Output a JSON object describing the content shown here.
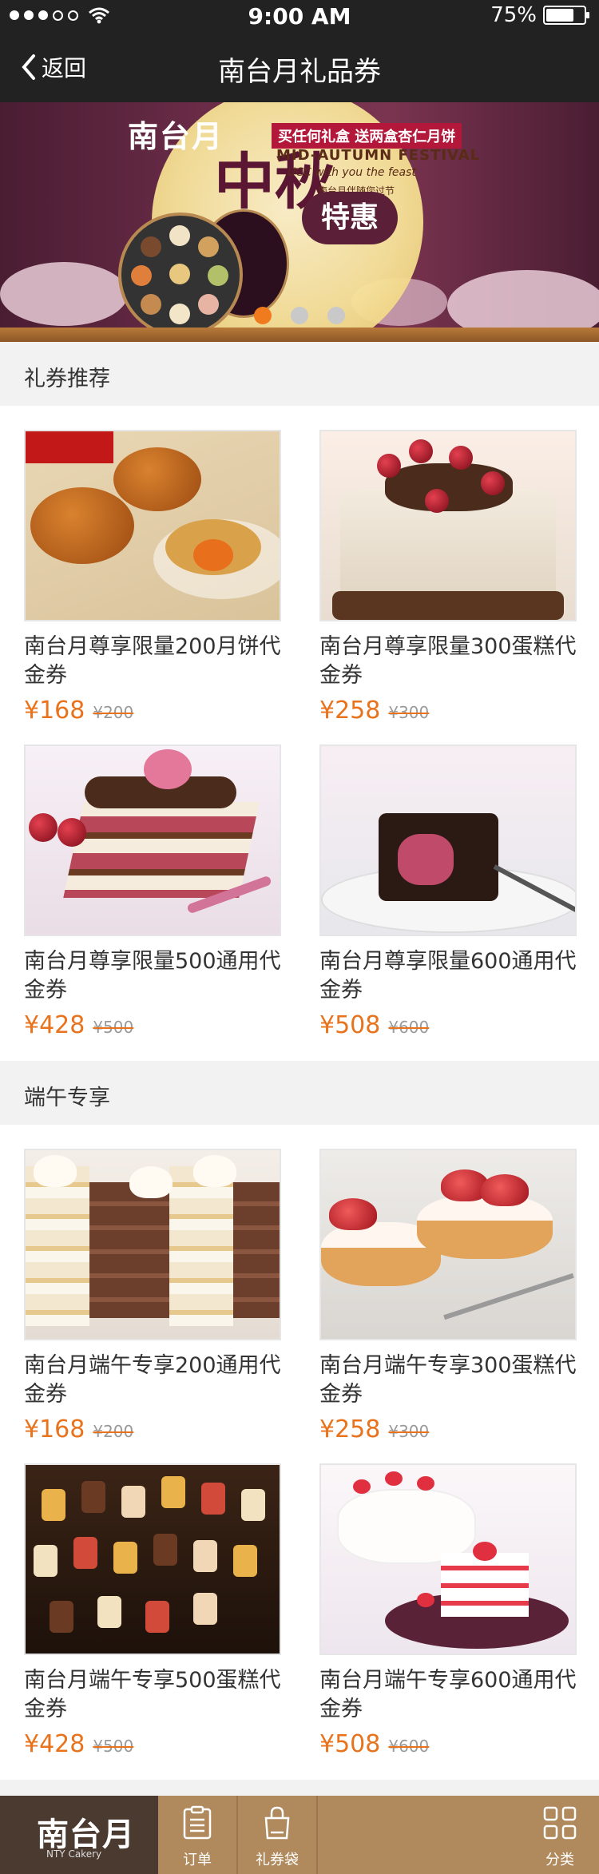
{
  "status_bar": {
    "time": "9:00 AM",
    "battery": "75%",
    "battery_level": 0.75
  },
  "nav": {
    "back_label": "返回",
    "title": "南台月礼品券"
  },
  "banner": {
    "brand": "南台月",
    "tag": "买任何礼盒 送两盒杏仁月饼",
    "title_en": "MID-AUTUMN FESTIVAL",
    "subtitle_en": "UCC with you the feast",
    "subtitle_cn": "南台月伴随您过节",
    "headline": "中秋",
    "badge": "特惠",
    "pager_count": 3,
    "pager_active": 0
  },
  "sections": [
    {
      "title": "礼券推荐",
      "items": [
        {
          "title": "南台月尊享限量200月饼代金券",
          "price": "¥168",
          "old_price": "¥200",
          "image": "mooncake"
        },
        {
          "title": "南台月尊享限量300蛋糕代金券",
          "price": "¥258",
          "old_price": "¥300",
          "image": "cherry-cake"
        },
        {
          "title": "南台月尊享限量500通用代金券",
          "price": "¥428",
          "old_price": "¥500",
          "image": "layer-slice"
        },
        {
          "title": "南台月尊享限量600通用代金券",
          "price": "¥508",
          "old_price": "¥600",
          "image": "chocolate-slice"
        }
      ]
    },
    {
      "title": "端午专享",
      "items": [
        {
          "title": "南台月端午专享200通用代金券",
          "price": "¥168",
          "old_price": "¥200",
          "image": "sliced-cakes"
        },
        {
          "title": "南台月端午专享300蛋糕代金券",
          "price": "¥258",
          "old_price": "¥300",
          "image": "strawberry-tarts"
        },
        {
          "title": "南台月端午专享500蛋糕代金券",
          "price": "¥428",
          "old_price": "¥500",
          "image": "mini-desserts"
        },
        {
          "title": "南台月端午专享600通用代金券",
          "price": "¥508",
          "old_price": "¥600",
          "image": "strawberry-cake"
        }
      ]
    }
  ],
  "tab_bar": {
    "logo": "南台月",
    "logo_sub": "NTY Cakery",
    "items": [
      {
        "label": "订单",
        "icon": "order-icon"
      },
      {
        "label": "礼券袋",
        "icon": "bag-icon"
      },
      {
        "label": "分类",
        "icon": "grid-icon"
      }
    ]
  },
  "colors": {
    "accent": "#e8731c",
    "nav_bg": "#222222",
    "tab_bg": "#b08a5c"
  }
}
